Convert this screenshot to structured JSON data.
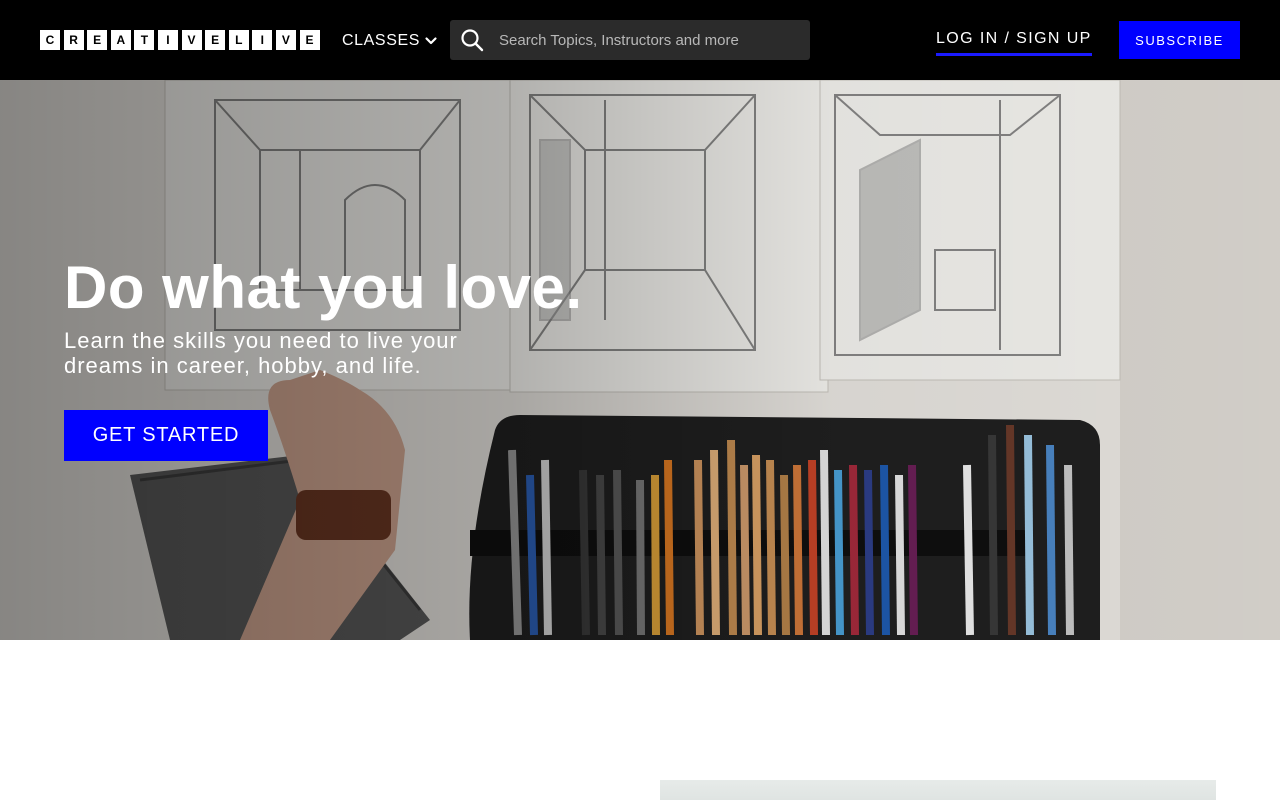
{
  "header": {
    "logo_letters": [
      "C",
      "R",
      "E",
      "A",
      "T",
      "I",
      "V",
      "E",
      "L",
      "I",
      "V",
      "E"
    ],
    "classes_label": "CLASSES",
    "search_placeholder": "Search Topics, Instructors and more",
    "login_label": "LOG IN / SIGN UP",
    "subscribe_label": "SUBSCRIBE"
  },
  "hero": {
    "title": "Do what you love.",
    "subtitle": "Learn the skills you need to live your dreams in career, hobby, and life.",
    "cta_label": "GET STARTED"
  },
  "colors": {
    "header_bg": "#000000",
    "brand_blue": "#0000ff",
    "search_bg": "#2b2b2b"
  }
}
